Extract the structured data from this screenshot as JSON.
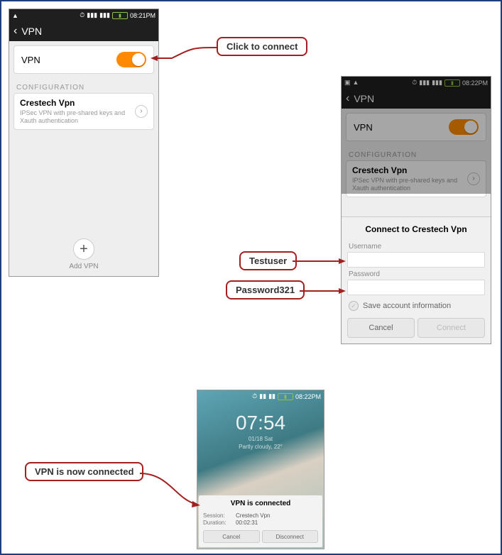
{
  "phone1": {
    "status": {
      "time": "08:21PM",
      "wifi": "wifi-icon",
      "signal1": "signal-icon",
      "signal2": "signal-icon"
    },
    "title": "VPN",
    "vpn_toggle_label": "VPN",
    "vpn_toggle_on": true,
    "config_heading": "CONFIGURATION",
    "vpn_entry": {
      "name": "Crestech Vpn",
      "desc": "IPSec VPN with pre-shared keys and Xauth authentication"
    },
    "add_vpn_label": "Add VPN"
  },
  "phone2": {
    "status": {
      "time": "08:22PM"
    },
    "title": "VPN",
    "vpn_toggle_label": "VPN",
    "config_heading": "CONFIGURATION",
    "vpn_entry": {
      "name": "Crestech Vpn",
      "desc": "IPSec VPN with pre-shared keys and Xauth authentication"
    },
    "modal": {
      "title": "Connect to Crestech Vpn",
      "username_label": "Username",
      "username_value": "",
      "password_label": "Password",
      "password_value": "",
      "save_label": "Save account information",
      "cancel": "Cancel",
      "connect": "Connect"
    }
  },
  "phone3": {
    "status": {
      "time": "08:22PM"
    },
    "lock": {
      "time": "07:54",
      "date": "01/18 Sat",
      "weather": "Partly cloudy, 22°"
    },
    "modal": {
      "title": "VPN is connected",
      "session_label": "Session:",
      "session_value": "Crestech Vpn",
      "duration_label": "Duration:",
      "duration_value": "00:02:31",
      "cancel": "Cancel",
      "disconnect": "Disconnect"
    }
  },
  "callouts": {
    "click_connect": "Click to connect",
    "testuser": "Testuser",
    "password": "Password321",
    "connected": "VPN is now connected"
  }
}
